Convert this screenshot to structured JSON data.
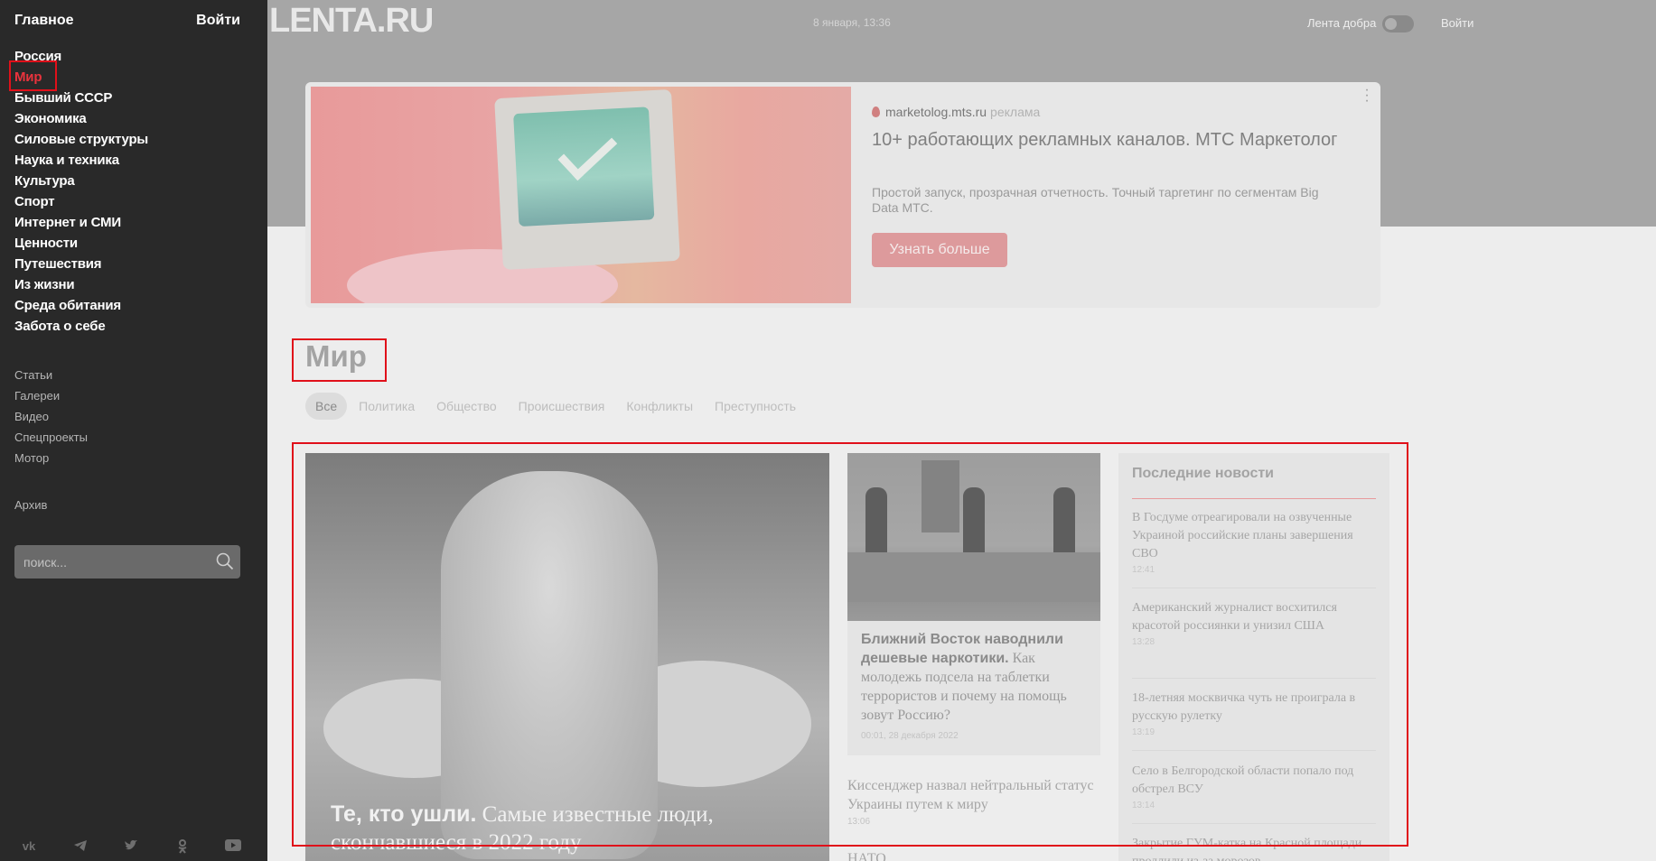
{
  "sidebar": {
    "home": "Главное",
    "login": "Войти",
    "main_items": [
      {
        "label": "Россия"
      },
      {
        "label": "Мир"
      },
      {
        "label": "Бывший СССР"
      },
      {
        "label": "Экономика"
      },
      {
        "label": "Силовые структуры"
      },
      {
        "label": "Наука и техника"
      },
      {
        "label": "Культура"
      },
      {
        "label": "Спорт"
      },
      {
        "label": "Интернет и СМИ"
      },
      {
        "label": "Ценности"
      },
      {
        "label": "Путешествия"
      },
      {
        "label": "Из жизни"
      },
      {
        "label": "Среда обитания"
      },
      {
        "label": "Забота о себе"
      }
    ],
    "active_item": "Мир",
    "secondary_items": [
      {
        "label": "Статьи"
      },
      {
        "label": "Галереи"
      },
      {
        "label": "Видео"
      },
      {
        "label": "Спецпроекты"
      },
      {
        "label": "Мотор"
      }
    ],
    "archive": "Архив",
    "search_placeholder": "поиск...",
    "social": [
      "vk-icon",
      "telegram-icon",
      "twitter-icon",
      "odnoklassniki-icon",
      "youtube-icon"
    ]
  },
  "header": {
    "logo": "LENTA.RU",
    "date": "8 января, 13:36",
    "lenta_dobra": "Лента добра",
    "login": "Войти"
  },
  "ad": {
    "domain": "marketolog.mts.ru",
    "tag": "реклама",
    "title": "10+ работающих рекламных каналов. МТС Маркетолог",
    "description": "Простой запуск, прозрачная отчетность. Точный таргетинг по сегментам Big Data МТС.",
    "button": "Узнать больше"
  },
  "section": {
    "title": "Мир",
    "tabs": [
      {
        "label": "Все"
      },
      {
        "label": "Политика"
      },
      {
        "label": "Общество"
      },
      {
        "label": "Происшествия"
      },
      {
        "label": "Конфликты"
      },
      {
        "label": "Преступность"
      }
    ]
  },
  "main_story": {
    "bold": "Те, кто ушли.",
    "text": " Самые известные люди, скончавшиеся в 2022 году"
  },
  "mid_story": {
    "bold": "Ближний Восток наводнили дешевые наркотики.",
    "text": " Как молодежь подсела на таблетки террористов и почему на помощь зовут Россию?",
    "time": "00:01, 28 декабря 2022"
  },
  "mid_news": [
    {
      "title": "Киссенджер назвал нейтральный статус Украины путем к миру",
      "time": "13:06"
    },
    {
      "title": "НАТО ..."
    }
  ],
  "latest": {
    "title": "Последние новости",
    "items": [
      {
        "title": "В Госдуме отреагировали на озвученные Украиной российские планы завершения СВО",
        "time": "12:41"
      },
      {
        "title": "Американский журналист восхитился красотой россиянки и унизил США",
        "time": "13:28"
      },
      {
        "title": "18-летняя москвичка чуть не проиграла в русскую рулетку",
        "time": "13:19"
      },
      {
        "title": "Село в Белгородской области попало под обстрел ВСУ",
        "time": "13:14"
      },
      {
        "title": "Закрытие ГУМ-катка на Красной площади продлили из-за морозов",
        "time": ""
      }
    ]
  }
}
